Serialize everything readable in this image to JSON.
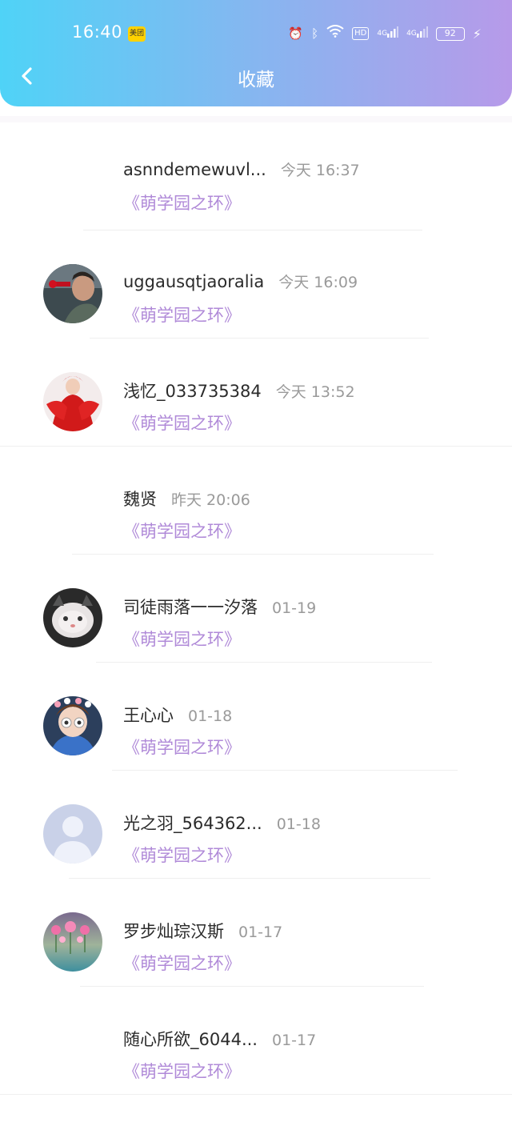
{
  "status_bar": {
    "time": "16:40",
    "meituan_label": "美团",
    "hd_label": "HD",
    "net1": "4G",
    "net2": "4G",
    "battery": "92"
  },
  "header": {
    "title": "收藏"
  },
  "items": [
    {
      "name": "asnndemewuvl...",
      "time": "今天 16:37",
      "book": "《萌学园之环》",
      "avatar": "none"
    },
    {
      "name": "uggausqtjaoralia",
      "time": "今天 16:09",
      "book": "《萌学园之环》",
      "avatar": "singer-photo"
    },
    {
      "name": "浅忆_033735384",
      "time": "今天 13:52",
      "book": "《萌学园之环》",
      "avatar": "red-costume-photo"
    },
    {
      "name": "魏贤",
      "time": "昨天 20:06",
      "book": "《萌学园之环》",
      "avatar": "none"
    },
    {
      "name": "司徒雨落一一汐落",
      "time": "01-19",
      "book": "《萌学园之环》",
      "avatar": "cat-photo"
    },
    {
      "name": "王心心",
      "time": "01-18",
      "book": "《萌学园之环》",
      "avatar": "child-photo"
    },
    {
      "name": "光之羽_564362...",
      "time": "01-18",
      "book": "《萌学园之环》",
      "avatar": "default-avatar"
    },
    {
      "name": "罗步灿琮汉斯",
      "time": "01-17",
      "book": "《萌学园之环》",
      "avatar": "flower-photo"
    },
    {
      "name": "随心所欲_6044...",
      "time": "01-17",
      "book": "《萌学园之环》",
      "avatar": "none"
    }
  ],
  "colors": {
    "accent_book": "#b08ad8",
    "header_start": "#4fd3f7",
    "header_end": "#b79ae9"
  }
}
